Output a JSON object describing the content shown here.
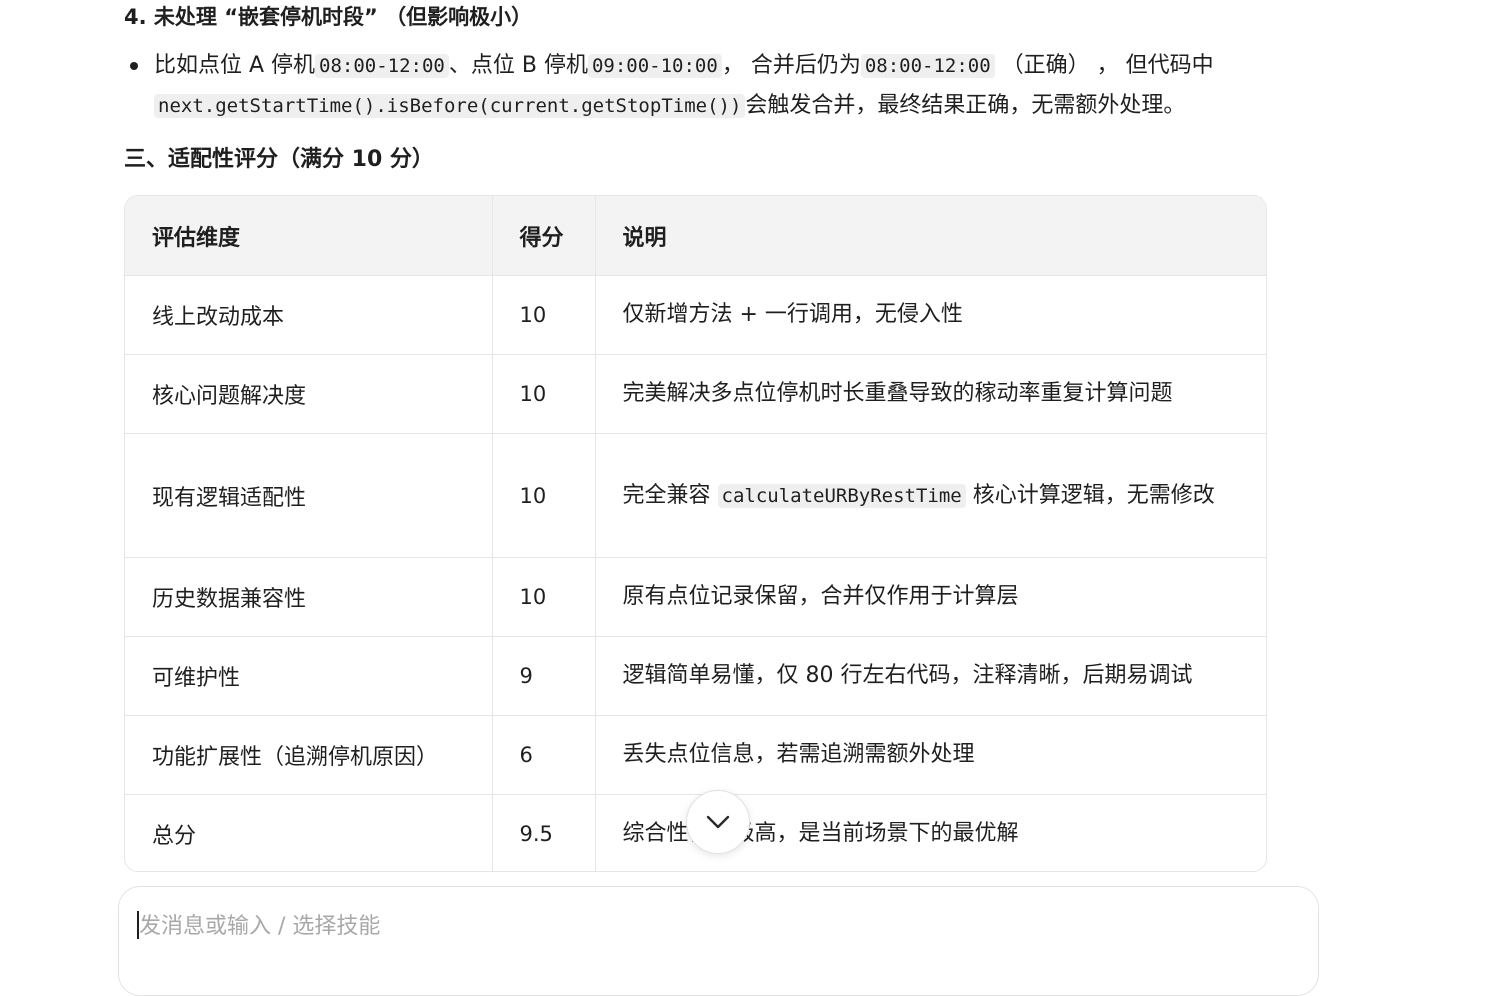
{
  "section4": {
    "heading": "4. 未处理 “嵌套停机时段” （但影响极小）",
    "bullet": {
      "t1": "比如点位 A 停机",
      "c1": "08:00-12:00",
      "t2": "、点位 B 停机",
      "c2": "09:00-10:00",
      "t3": "， 合并后仍为",
      "c3": "08:00-12:00",
      "t4": " （正确） ， 但代码中 ",
      "c4": "next.getStartTime().isBefore(current.getStopTime())",
      "t5": "会触发合并，最终结果正确，无需额外处理。"
    }
  },
  "section3": {
    "heading": "三、适配性评分（满分 10 分）"
  },
  "table": {
    "headers": [
      "评估维度",
      "得分",
      "说明"
    ],
    "rows": [
      {
        "dim": "线上改动成本",
        "score": "10",
        "desc": "仅新增方法 + 一行调用，无侵入性"
      },
      {
        "dim": "核心问题解决度",
        "score": "10",
        "desc": "完美解决多点位停机时长重叠导致的稼动率重复计算问题"
      },
      {
        "dim": "现有逻辑适配性",
        "score": "10",
        "desc_pre": "完全兼容 ",
        "desc_code": "calculateURByRestTime",
        "desc_post": " 核心计算逻辑，无需修改"
      },
      {
        "dim": "历史数据兼容性",
        "score": "10",
        "desc": "原有点位记录保留，合并仅作用于计算层"
      },
      {
        "dim": "可维护性",
        "score": "9",
        "desc": "逻辑简单易懂，仅 80 行左右代码，注释清晰，后期易调试"
      },
      {
        "dim": "功能扩展性（追溯停机原因）",
        "score": "6",
        "desc": "丢失点位信息，若需追溯需额外处理"
      },
      {
        "dim": "总分",
        "score": "9.5",
        "desc": "综合性价比极高，是当前场景下的最优解"
      }
    ]
  },
  "composer": {
    "placeholder": "发消息或输入 / 选择技能"
  },
  "icons": {
    "scroll_down": "chevron-down-icon"
  }
}
